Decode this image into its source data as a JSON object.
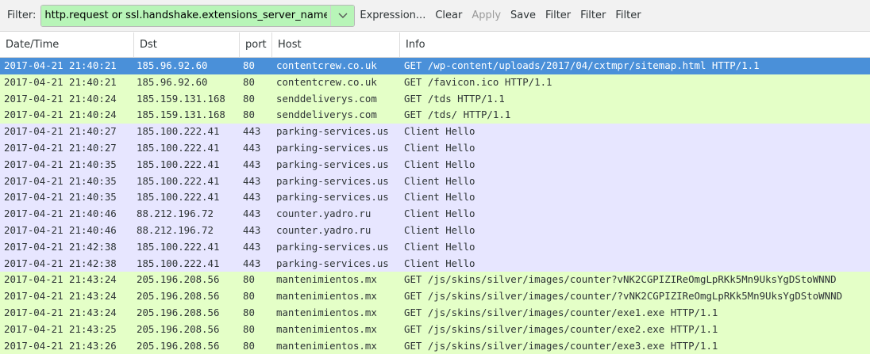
{
  "toolbar": {
    "filter_label": "Filter:",
    "filter_value": "http.request or ssl.handshake.extensions_server_name",
    "buttons": [
      "Expression...",
      "Clear",
      "Apply",
      "Save",
      "Filter",
      "Filter",
      "Filter"
    ]
  },
  "table": {
    "columns": [
      "Date/Time",
      "Dst",
      "port",
      "Host",
      "Info"
    ],
    "rows": [
      {
        "type": "http",
        "selected": true,
        "date": "2017-04-21 21:40:21",
        "dst": "185.96.92.60",
        "port": "80",
        "host": "contentcrew.co.uk",
        "info": "GET /wp-content/uploads/2017/04/cxtmpr/sitemap.html HTTP/1.1"
      },
      {
        "type": "http",
        "date": "2017-04-21 21:40:21",
        "dst": "185.96.92.60",
        "port": "80",
        "host": "contentcrew.co.uk",
        "info": "GET /favicon.ico HTTP/1.1"
      },
      {
        "type": "http",
        "date": "2017-04-21 21:40:24",
        "dst": "185.159.131.168",
        "port": "80",
        "host": "senddeliverys.com",
        "info": "GET /tds HTTP/1.1"
      },
      {
        "type": "http",
        "date": "2017-04-21 21:40:24",
        "dst": "185.159.131.168",
        "port": "80",
        "host": "senddeliverys.com",
        "info": "GET /tds/ HTTP/1.1"
      },
      {
        "type": "ssl",
        "date": "2017-04-21 21:40:27",
        "dst": "185.100.222.41",
        "port": "443",
        "host": "parking-services.us",
        "info": "Client Hello"
      },
      {
        "type": "ssl",
        "date": "2017-04-21 21:40:27",
        "dst": "185.100.222.41",
        "port": "443",
        "host": "parking-services.us",
        "info": "Client Hello"
      },
      {
        "type": "ssl",
        "date": "2017-04-21 21:40:35",
        "dst": "185.100.222.41",
        "port": "443",
        "host": "parking-services.us",
        "info": "Client Hello"
      },
      {
        "type": "ssl",
        "date": "2017-04-21 21:40:35",
        "dst": "185.100.222.41",
        "port": "443",
        "host": "parking-services.us",
        "info": "Client Hello"
      },
      {
        "type": "ssl",
        "date": "2017-04-21 21:40:35",
        "dst": "185.100.222.41",
        "port": "443",
        "host": "parking-services.us",
        "info": "Client Hello"
      },
      {
        "type": "ssl",
        "date": "2017-04-21 21:40:46",
        "dst": "88.212.196.72",
        "port": "443",
        "host": "counter.yadro.ru",
        "info": "Client Hello"
      },
      {
        "type": "ssl",
        "date": "2017-04-21 21:40:46",
        "dst": "88.212.196.72",
        "port": "443",
        "host": "counter.yadro.ru",
        "info": "Client Hello"
      },
      {
        "type": "ssl",
        "date": "2017-04-21 21:42:38",
        "dst": "185.100.222.41",
        "port": "443",
        "host": "parking-services.us",
        "info": "Client Hello"
      },
      {
        "type": "ssl",
        "date": "2017-04-21 21:42:38",
        "dst": "185.100.222.41",
        "port": "443",
        "host": "parking-services.us",
        "info": "Client Hello"
      },
      {
        "type": "http",
        "date": "2017-04-21 21:43:24",
        "dst": "205.196.208.56",
        "port": "80",
        "host": "mantenimientos.mx",
        "info": "GET /js/skins/silver/images/counter?vNK2CGPIZIReOmgLpRKk5Mn9UksYgDStoWNND"
      },
      {
        "type": "http",
        "date": "2017-04-21 21:43:24",
        "dst": "205.196.208.56",
        "port": "80",
        "host": "mantenimientos.mx",
        "info": "GET /js/skins/silver/images/counter/?vNK2CGPIZIReOmgLpRKk5Mn9UksYgDStoWNND"
      },
      {
        "type": "http",
        "date": "2017-04-21 21:43:24",
        "dst": "205.196.208.56",
        "port": "80",
        "host": "mantenimientos.mx",
        "info": "GET /js/skins/silver/images/counter/exe1.exe HTTP/1.1"
      },
      {
        "type": "http",
        "date": "2017-04-21 21:43:25",
        "dst": "205.196.208.56",
        "port": "80",
        "host": "mantenimientos.mx",
        "info": "GET /js/skins/silver/images/counter/exe2.exe HTTP/1.1"
      },
      {
        "type": "http",
        "date": "2017-04-21 21:43:26",
        "dst": "205.196.208.56",
        "port": "80",
        "host": "mantenimientos.mx",
        "info": "GET /js/skins/silver/images/counter/exe3.exe HTTP/1.1"
      }
    ]
  },
  "colors": {
    "http_row": "#e4ffc7",
    "ssl_row": "#e7e6ff",
    "selected_row": "#4a90d9",
    "filter_ok": "#b8f5b8"
  }
}
